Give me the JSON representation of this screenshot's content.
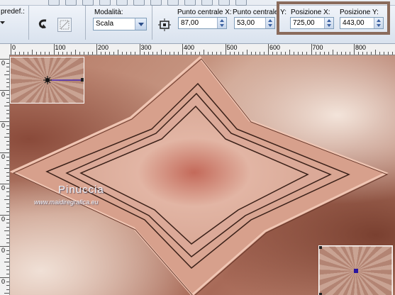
{
  "toolbar": {
    "preset_label": "predef.:",
    "mode_label": "Modalità:",
    "mode_value": "Scala",
    "center_x_label": "Punto centrale X:",
    "center_x_value": "87,00",
    "center_y_label": "Punto centrale Y:",
    "center_y_value": "53,00",
    "pos_x_label": "Posizione X:",
    "pos_x_value": "725,00",
    "pos_y_label": "Posizione Y:",
    "pos_y_value": "443,00"
  },
  "ruler": {
    "marks": [
      "0",
      "100",
      "200",
      "300",
      "400",
      "500",
      "600",
      "700",
      "800"
    ],
    "v_marks": [
      "0",
      "0",
      "0",
      "0",
      "0",
      "0",
      "0",
      "0"
    ]
  },
  "watermark": {
    "title": "Pinuccia",
    "url": "www.maidiregrafica.eu"
  },
  "colors": {
    "highlight_border": "#8a6b5c",
    "canvas_base": "#c99a86",
    "star_edge": "#e8b8a6",
    "handle_line": "#4b2bb8"
  },
  "icons": [
    "undo-icon",
    "flip-icon",
    "move-center-icon"
  ]
}
